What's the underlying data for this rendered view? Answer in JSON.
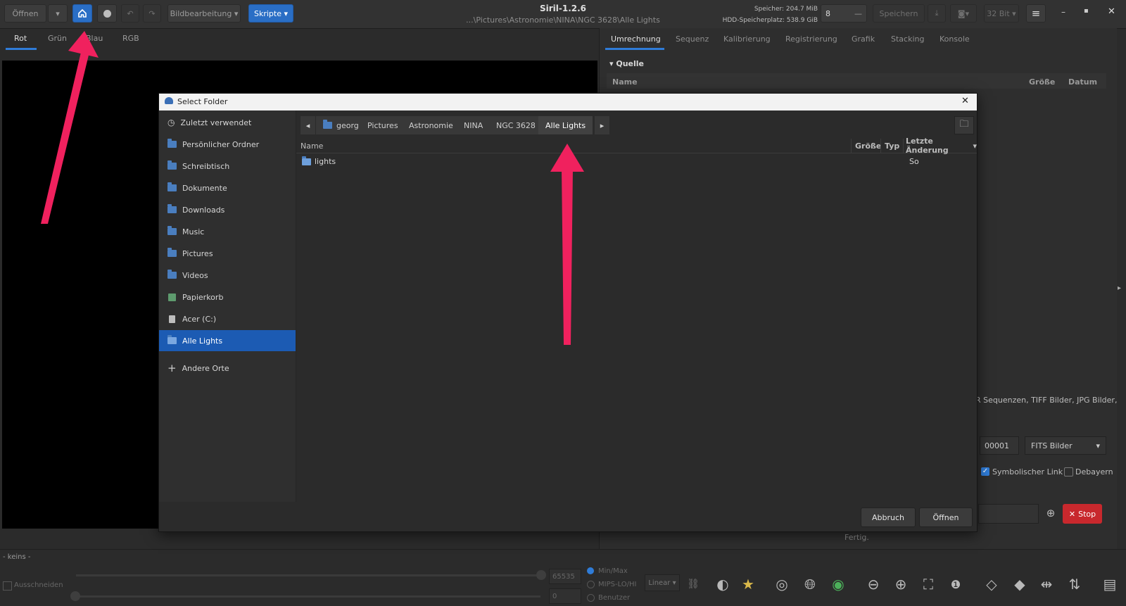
{
  "header": {
    "open_label": "Öffnen",
    "image_processing_label": "Bildbearbeitung",
    "scripts_label": "Skripte",
    "app_title": "Siril-1.2.6",
    "path": "...\\Pictures\\Astronomie\\NINA\\NGC 3628\\Alle Lights",
    "memory": "Speicher: 204.7 MiB",
    "disk": "HDD-Speicherplatz: 538.9 GiB",
    "threads_value": "8",
    "save_label": "Speichern",
    "bitdepth_label": "32 Bit"
  },
  "left_tabs": [
    "Rot",
    "Grün",
    "Blau",
    "RGB"
  ],
  "right_tabs": [
    "Umrechnung",
    "Sequenz",
    "Kalibrierung",
    "Registrierung",
    "Grafik",
    "Stacking",
    "Konsole"
  ],
  "right_pane": {
    "section_title": "Quelle",
    "col_name": "Name",
    "col_size": "Größe",
    "col_date": "Datum",
    "formats_text": "R Sequenzen, TIFF Bilder, JPG Bilder,",
    "index_value": "00001",
    "format_select": "FITS Bilder",
    "symlink_label": "Symbolischer Link",
    "debayer_label": "Debayern",
    "stop_label": "Stop",
    "status_text": "Fertig."
  },
  "bottom": {
    "none_label": "- keins -",
    "crop_label": "Ausschneiden",
    "max_value": "65535",
    "min_value": "0",
    "radio_minmax": "Min/Max",
    "radio_mips": "MIPS-LO/HI",
    "radio_user": "Benutzer",
    "stretch_select": "Linear"
  },
  "dialog": {
    "title": "Select Folder",
    "sidebar": [
      {
        "label": "Zuletzt verwendet",
        "icon": "clock-icon"
      },
      {
        "label": "Persönlicher Ordner",
        "icon": "folder-icon"
      },
      {
        "label": "Schreibtisch",
        "icon": "folder-icon"
      },
      {
        "label": "Dokumente",
        "icon": "folder-icon"
      },
      {
        "label": "Downloads",
        "icon": "folder-icon"
      },
      {
        "label": "Music",
        "icon": "folder-icon"
      },
      {
        "label": "Pictures",
        "icon": "folder-icon"
      },
      {
        "label": "Videos",
        "icon": "folder-icon"
      },
      {
        "label": "Papierkorb",
        "icon": "trash-icon"
      },
      {
        "label": "Acer (C:)",
        "icon": "drive-icon"
      },
      {
        "label": "Alle Lights",
        "icon": "folder-icon",
        "active": true
      }
    ],
    "other_places": "Andere Orte",
    "breadcrumbs": [
      "georg",
      "Pictures",
      "Astronomie",
      "NINA",
      "NGC 3628",
      "Alle Lights"
    ],
    "columns": {
      "name": "Name",
      "size": "Größe",
      "type": "Typ",
      "modified": "Letzte Änderung"
    },
    "files": [
      {
        "name": "lights",
        "modified": "So"
      }
    ],
    "cancel_label": "Abbruch",
    "open_label": "Öffnen"
  },
  "colors": {
    "accent": "#2f7cd8",
    "annotation_arrow": "#f0215e",
    "stop_red": "#c8282d"
  }
}
